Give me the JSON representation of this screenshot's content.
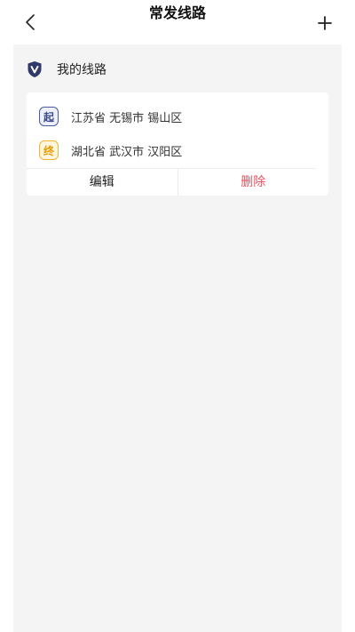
{
  "header": {
    "title": "常发线路",
    "back_icon": "chevron-left-icon",
    "add_icon": "plus-icon"
  },
  "section": {
    "icon": "shield-v-icon",
    "title": "我的线路"
  },
  "route": {
    "start_badge": "起",
    "start_address": "江苏省 无锡市 锡山区",
    "end_badge": "终",
    "end_address": "湖北省 武汉市 汉阳区",
    "edit_label": "编辑",
    "delete_label": "删除"
  },
  "colors": {
    "shield": "#2f3a6b",
    "start": "#4a5a9a",
    "end": "#f1b530",
    "delete": "#e8525e",
    "background": "#f4f4f4"
  }
}
